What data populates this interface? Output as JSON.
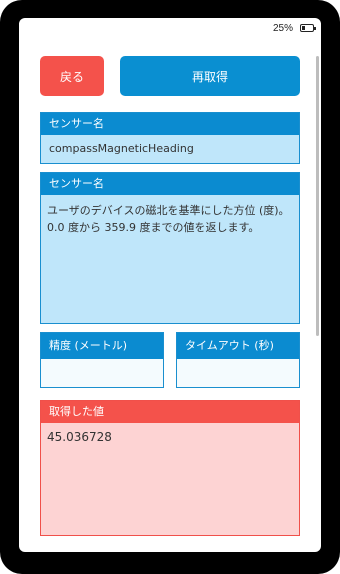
{
  "status": {
    "battery": "25%"
  },
  "buttons": {
    "back": "戻る",
    "refetch": "再取得"
  },
  "sensor_name_panel": {
    "header": "センサー名",
    "value": "compassMagneticHeading"
  },
  "sensor_desc_panel": {
    "header": "センサー名",
    "description": "ユーザのデバイスの磁北を基準にした方位 (度)。0.0 度から 359.9 度までの値を返します。"
  },
  "accuracy_panel": {
    "header": "精度 (メートル)",
    "value": ""
  },
  "timeout_panel": {
    "header": "タイムアウト (秒)",
    "value": ""
  },
  "result_panel": {
    "header": "取得した値",
    "value": "45.036728"
  },
  "colors": {
    "primary": "#0b8bd0",
    "danger": "#f4524b",
    "panel_bg": "#bfe6fa",
    "result_bg": "#fdd3d3"
  },
  "icons": {
    "battery": "battery-icon"
  }
}
